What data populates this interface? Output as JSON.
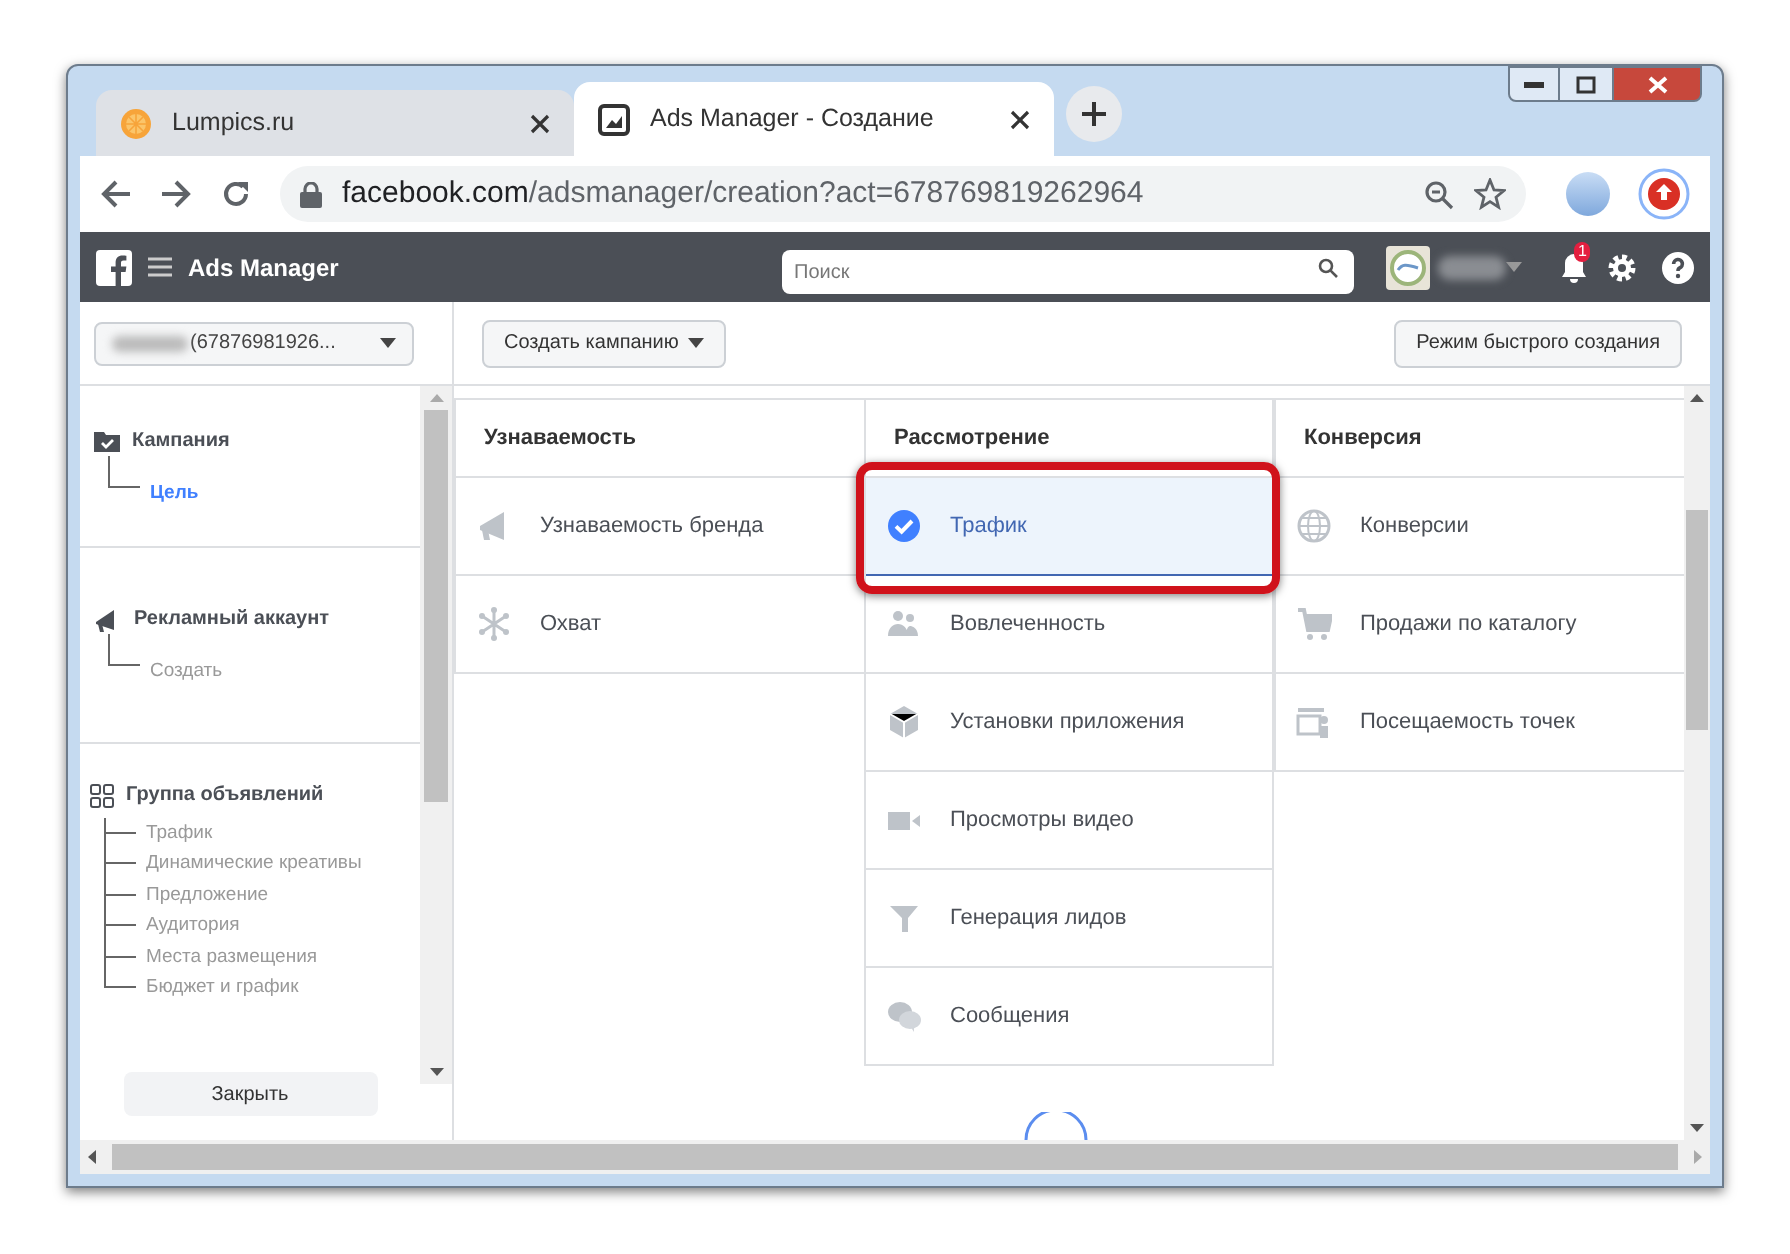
{
  "browser": {
    "tabs": [
      {
        "title": "Lumpics.ru",
        "kind": "orange",
        "selected": false
      },
      {
        "title": "Ads Manager - Создание",
        "kind": "page",
        "selected": true
      }
    ],
    "url": {
      "domain": "facebook.com",
      "path": "/adsmanager/creation?act=678769819262964"
    }
  },
  "app": {
    "title": "Ads Manager",
    "search": {
      "placeholder": "Поиск"
    },
    "notifications": "1"
  },
  "sidebar": {
    "account": "(67876981926...",
    "sections": [
      {
        "kind": "campaign",
        "title": "Кампания",
        "children": [
          {
            "label": "Цель",
            "selected": true
          }
        ]
      },
      {
        "kind": "account",
        "title": "Рекламный аккаунт",
        "children": [
          {
            "label": "Создать",
            "selected": false
          }
        ]
      },
      {
        "kind": "adset",
        "title": "Группа объявлений",
        "children": [
          {
            "label": "Трафик",
            "selected": false
          },
          {
            "label": "Динамические креативы",
            "selected": false
          },
          {
            "label": "Предложение",
            "selected": false
          },
          {
            "label": "Аудитория",
            "selected": false
          },
          {
            "label": "Места размещения",
            "selected": false
          },
          {
            "label": "Бюджет и график",
            "selected": false
          }
        ]
      }
    ],
    "close_button": "Закрыть"
  },
  "toolbar": {
    "create_button": "Создать кампанию",
    "quick_button": "Режим быстрого создания"
  },
  "objectives": {
    "columns": [
      {
        "title": "Узнаваемость",
        "items": [
          {
            "label": "Узнаваемость бренда",
            "kind": "megaphone",
            "selected": false
          },
          {
            "label": "Охват",
            "kind": "reach",
            "selected": false
          }
        ]
      },
      {
        "title": "Рассмотрение",
        "items": [
          {
            "label": "Трафик",
            "kind": "traffic",
            "selected": true
          },
          {
            "label": "Вовлеченность",
            "kind": "people",
            "selected": false
          },
          {
            "label": "Установки приложения",
            "kind": "cube",
            "selected": false
          },
          {
            "label": "Просмотры видео",
            "kind": "video",
            "selected": false
          },
          {
            "label": "Генерация лидов",
            "kind": "funnel",
            "selected": false
          },
          {
            "label": "Сообщения",
            "kind": "chat",
            "selected": false
          }
        ]
      },
      {
        "title": "Конверсия",
        "items": [
          {
            "label": "Конверсии",
            "kind": "globe",
            "selected": false
          },
          {
            "label": "Продажи по каталогу",
            "kind": "cart",
            "selected": false
          },
          {
            "label": "Посещаемость точек",
            "kind": "store",
            "selected": false
          }
        ]
      }
    ]
  }
}
